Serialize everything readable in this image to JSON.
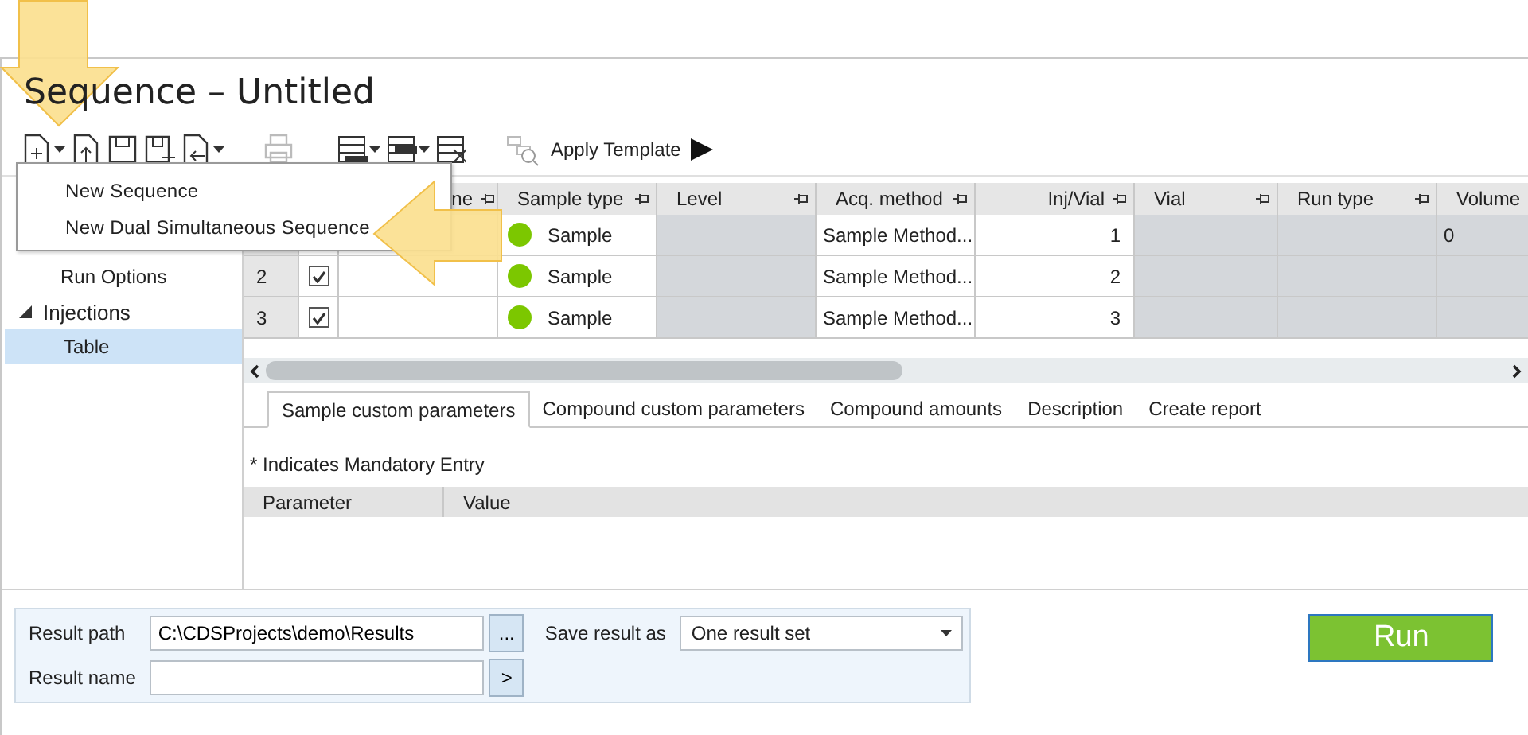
{
  "window": {
    "title": "Sequence – Untitled"
  },
  "toolbar": {
    "apply_template": "Apply Template"
  },
  "dropdown_menu": {
    "items": [
      {
        "label": "New Sequence"
      },
      {
        "label": "New Dual Simultaneous Sequence"
      }
    ]
  },
  "sidebar": {
    "items": [
      {
        "label": "Run Options",
        "kind": "item",
        "selected": false
      },
      {
        "label": "Injections",
        "kind": "group",
        "expanded": true,
        "children": [
          {
            "label": "Table",
            "selected": true
          }
        ]
      }
    ]
  },
  "table": {
    "columns": [
      {
        "label": "ne",
        "kind": "text",
        "disabled": false
      },
      {
        "label": "Sample type",
        "kind": "text",
        "disabled": false
      },
      {
        "label": "Level",
        "kind": "text",
        "disabled": true
      },
      {
        "label": "Acq. method",
        "kind": "text",
        "disabled": false
      },
      {
        "label": "Inj/Vial",
        "kind": "number",
        "disabled": false
      },
      {
        "label": "Vial",
        "kind": "text",
        "disabled": true
      },
      {
        "label": "Run type",
        "kind": "text",
        "disabled": true
      },
      {
        "label": "Volume",
        "kind": "text",
        "disabled": true
      }
    ],
    "rows": [
      {
        "cells": [
          null,
          {
            "label": "Sample",
            "color": "#7cc700"
          },
          null,
          "Sample Method...",
          "1",
          null,
          null,
          "0"
        ]
      },
      {
        "number": "2",
        "checked": true,
        "cells": [
          null,
          {
            "label": "Sample",
            "color": "#7cc700"
          },
          null,
          "Sample Method...",
          "2",
          null,
          null,
          null
        ]
      },
      {
        "number": "3",
        "checked": true,
        "cells": [
          null,
          {
            "label": "Sample",
            "color": "#7cc700"
          },
          null,
          "Sample Method...",
          "3",
          null,
          null,
          null
        ]
      }
    ]
  },
  "tabs": [
    {
      "label": "Sample custom parameters",
      "selected": true
    },
    {
      "label": "Compound custom parameters",
      "selected": false
    },
    {
      "label": "Compound amounts",
      "selected": false
    },
    {
      "label": "Description",
      "selected": false
    },
    {
      "label": "Create report",
      "selected": false
    }
  ],
  "mandatory_note": "* Indicates Mandatory Entry",
  "parameters": {
    "columns": [
      "Parameter",
      "Value"
    ]
  },
  "result_settings": {
    "result_path": {
      "label": "Result path",
      "value": "C:\\CDSProjects\\demo\\Results"
    },
    "browse_button": "...",
    "result_name": {
      "label": "Result name"
    },
    "apply_button": ">",
    "save_result_as": {
      "label": "Save result as",
      "value": "One result set"
    }
  },
  "run_button": "Run"
}
